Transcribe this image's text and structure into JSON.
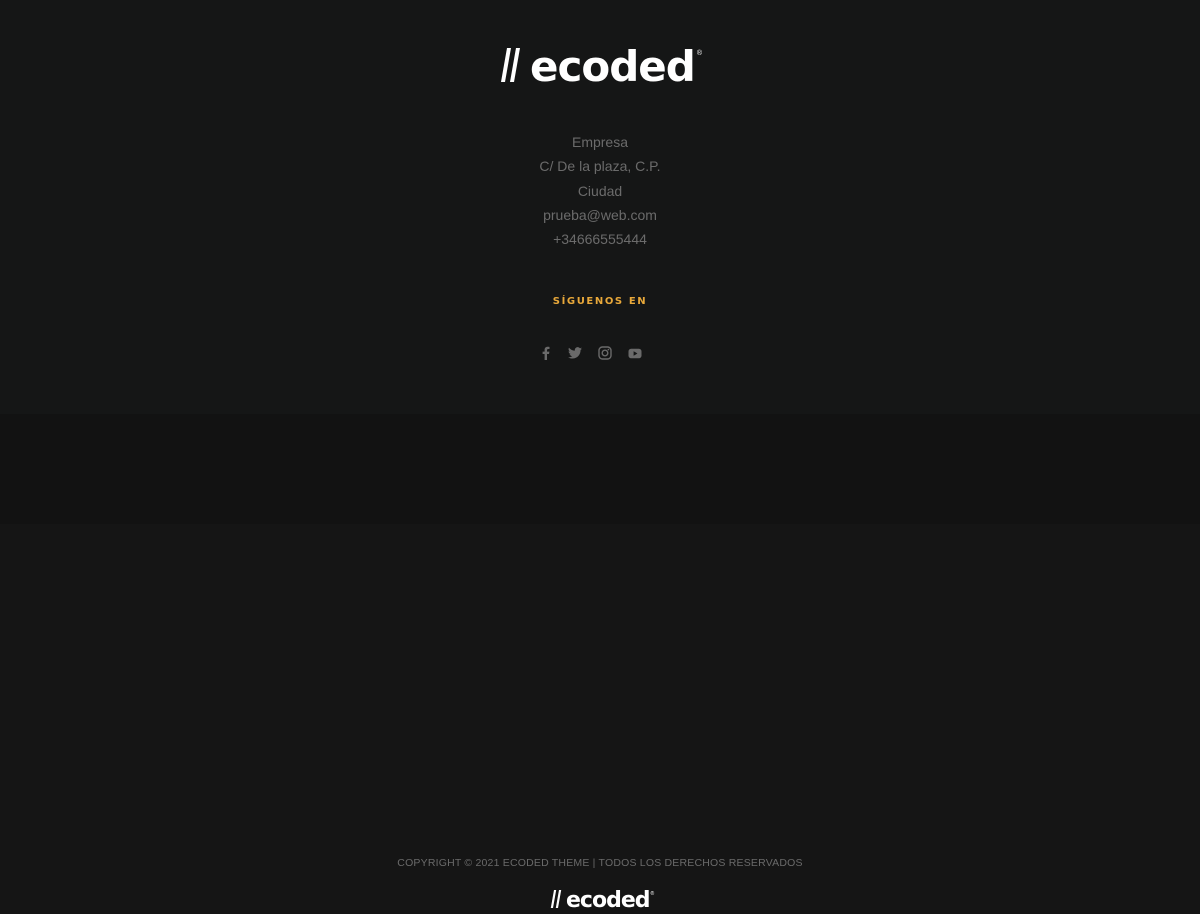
{
  "brand": {
    "name": "ecoded",
    "reg_mark": "®",
    "logo_color": "#ffffff"
  },
  "contact": {
    "company": "Empresa",
    "address": "C/ De la plaza, C.P.",
    "city": "Ciudad",
    "email": "prueba@web.com",
    "phone": "+34666555444"
  },
  "social": {
    "heading": "SÍGUENOS EN",
    "heading_color": "#e8a83a",
    "icons": [
      "facebook-icon",
      "twitter-icon",
      "instagram-icon",
      "youtube-icon"
    ]
  },
  "footer": {
    "copyright": "COPYRIGHT © 2021 ECODED THEME | TODOS LOS DERECHOS RESERVADOS"
  },
  "colors": {
    "background": "#151616",
    "bottom_bar": "#121212",
    "text_muted": "#6b6b6b"
  }
}
